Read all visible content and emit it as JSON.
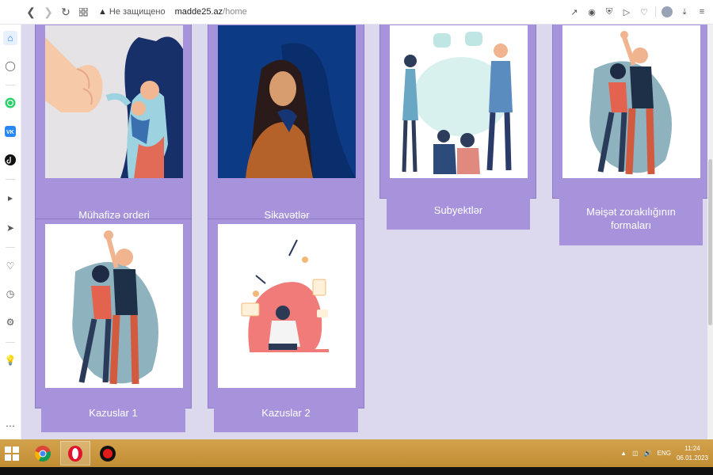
{
  "browser": {
    "security_label": "Не защищено",
    "url_host": "madde25.az",
    "url_path": "/home"
  },
  "sidebar_icons": [
    "home-icon",
    "compass-icon",
    "whatsapp-icon",
    "vk-icon",
    "tiktok-icon",
    "play-circle-icon",
    "send-icon",
    "heart-icon",
    "clock-icon",
    "gear-icon",
    "lightbulb-icon",
    "more-icon"
  ],
  "cards": [
    {
      "id": "muhafize-orderi",
      "label": "Mühafizə orderi"
    },
    {
      "id": "sikayetler",
      "label": "Şikayətlər"
    },
    {
      "id": "subyektler",
      "label": "Subyektlər"
    },
    {
      "id": "meiset-zorakiligi",
      "label": "Məişət zorakılığının formaları"
    },
    {
      "id": "kazuslar-1",
      "label": "Kazuslar 1"
    },
    {
      "id": "kazuslar-2",
      "label": "Kazuslar 2"
    }
  ],
  "taskbar": {
    "apps": [
      "chrome-app",
      "opera-app",
      "recorder-app"
    ],
    "language": "ENG",
    "time": "11:24",
    "date": "06.01.2023"
  },
  "colors": {
    "page_bg": "#dcd9ee",
    "card_purple": "#a793dc",
    "taskbar": "#c8963c"
  }
}
